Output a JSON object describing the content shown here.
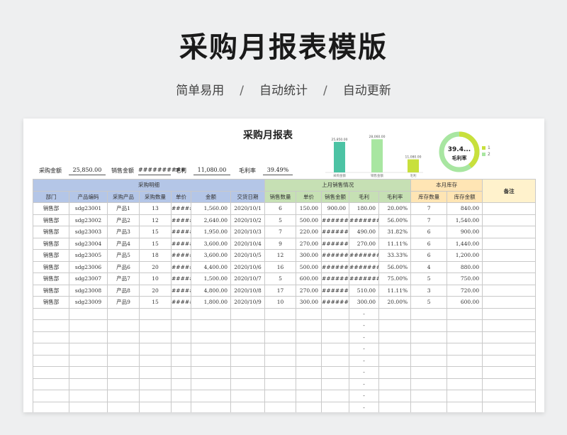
{
  "hero": {
    "title": "采购月报表模版",
    "subtitle": [
      "简单易用",
      "自动统计",
      "自动更新"
    ],
    "separator": "/"
  },
  "sheet": {
    "title": "采购月报表",
    "summary": [
      {
        "label": "采购金额",
        "value": "25,850.00"
      },
      {
        "label": "销售金额",
        "value": "##########"
      },
      {
        "label": "毛利",
        "value": "11,080.00"
      },
      {
        "label": "毛利率",
        "value": "39.49%"
      }
    ],
    "chart_data": {
      "type": "bar",
      "categories": [
        "采购金额",
        "销售金额",
        "毛利"
      ],
      "values": [
        25850,
        28060,
        11080
      ],
      "data_labels": [
        "25,850.00",
        "28,060.00",
        "11,080.00"
      ],
      "colors": [
        "#4cc3a4",
        "#a8e6a1",
        "#c8e03c"
      ],
      "ylim": [
        0,
        30000
      ]
    },
    "donut": {
      "value_text": "39.4...",
      "label": "毛利率",
      "fraction": 0.3949,
      "legend": [
        "1",
        "2"
      ],
      "colors": [
        "#c8e03c",
        "#a8e6a1"
      ]
    },
    "table": {
      "group_headers": [
        "采购明细",
        "上月销售情况",
        "本月库存",
        "备注"
      ],
      "columns": [
        "部门",
        "产品编码",
        "采购产品",
        "采购数量",
        "单价",
        "金额",
        "交货日期",
        "销售数量",
        "单价",
        "销售金额",
        "毛利",
        "毛利率",
        "库存数量",
        "库存金额"
      ],
      "rows": [
        [
          "销售部",
          "sdg23001",
          "产品1",
          "13",
          "######",
          "1,560.00",
          "2020/10/1",
          "6",
          "150.00",
          "900.00",
          "180.00",
          "20.00%",
          "7",
          "840.00",
          ""
        ],
        [
          "销售部",
          "sdg23002",
          "产品2",
          "12",
          "######",
          "2,640.00",
          "2020/10/2",
          "5",
          "500.00",
          "#########",
          "#########",
          "56.00%",
          "7",
          "1,540.00",
          ""
        ],
        [
          "销售部",
          "sdg23003",
          "产品3",
          "15",
          "######",
          "1,950.00",
          "2020/10/3",
          "7",
          "220.00",
          "#########",
          "490.00",
          "31.82%",
          "6",
          "900.00",
          ""
        ],
        [
          "销售部",
          "sdg23004",
          "产品4",
          "15",
          "######",
          "3,600.00",
          "2020/10/4",
          "9",
          "270.00",
          "#########",
          "270.00",
          "11.11%",
          "6",
          "1,440.00",
          ""
        ],
        [
          "销售部",
          "sdg23005",
          "产品5",
          "18",
          "######",
          "3,600.00",
          "2020/10/5",
          "12",
          "300.00",
          "#########",
          "#########",
          "33.33%",
          "6",
          "1,200.00",
          ""
        ],
        [
          "销售部",
          "sdg23006",
          "产品6",
          "20",
          "######",
          "4,400.00",
          "2020/10/6",
          "16",
          "500.00",
          "#########",
          "#########",
          "56.00%",
          "4",
          "880.00",
          ""
        ],
        [
          "销售部",
          "sdg23007",
          "产品7",
          "10",
          "######",
          "1,500.00",
          "2020/10/7",
          "5",
          "600.00",
          "#########",
          "#########",
          "75.00%",
          "5",
          "750.00",
          ""
        ],
        [
          "销售部",
          "sdg23008",
          "产品8",
          "20",
          "######",
          "4,800.00",
          "2020/10/8",
          "17",
          "270.00",
          "#########",
          "510.00",
          "11.11%",
          "3",
          "720.00",
          ""
        ],
        [
          "销售部",
          "sdg23009",
          "产品9",
          "15",
          "######",
          "1,800.00",
          "2020/10/9",
          "10",
          "300.00",
          "#########",
          "300.00",
          "20.00%",
          "5",
          "600.00",
          ""
        ],
        [
          "",
          "",
          "",
          "",
          "",
          "",
          "",
          "",
          "",
          "",
          "-",
          "",
          "",
          "",
          ""
        ],
        [
          "",
          "",
          "",
          "",
          "",
          "",
          "",
          "",
          "",
          "",
          "-",
          "",
          "",
          "",
          ""
        ],
        [
          "",
          "",
          "",
          "",
          "",
          "",
          "",
          "",
          "",
          "",
          "-",
          "",
          "",
          "",
          ""
        ],
        [
          "",
          "",
          "",
          "",
          "",
          "",
          "",
          "",
          "",
          "",
          "-",
          "",
          "",
          "",
          ""
        ],
        [
          "",
          "",
          "",
          "",
          "",
          "",
          "",
          "",
          "",
          "",
          "-",
          "",
          "",
          "",
          ""
        ],
        [
          "",
          "",
          "",
          "",
          "",
          "",
          "",
          "",
          "",
          "",
          "-",
          "",
          "",
          "",
          ""
        ],
        [
          "",
          "",
          "",
          "",
          "",
          "",
          "",
          "",
          "",
          "",
          "-",
          "",
          "",
          "",
          ""
        ],
        [
          "",
          "",
          "",
          "",
          "",
          "",
          "",
          "",
          "",
          "",
          "-",
          "",
          "",
          "",
          ""
        ],
        [
          "",
          "",
          "",
          "",
          "",
          "",
          "",
          "",
          "",
          "",
          "-",
          "",
          "",
          "",
          ""
        ]
      ]
    }
  }
}
